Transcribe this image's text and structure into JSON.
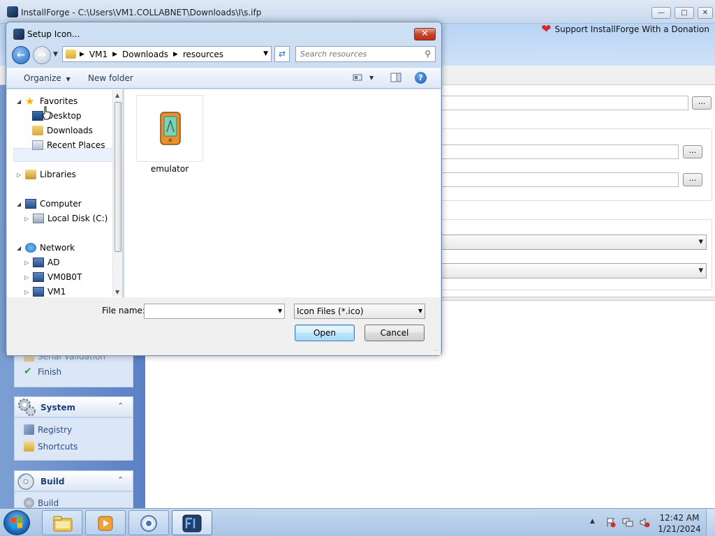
{
  "main_window": {
    "title": "InstallForge - C:\\Users\\VM1.COLLABNET\\Downloads\\I\\s.ifp",
    "donate_label": "Support InstallForge With a Donation",
    "minimize_glyph": "—",
    "maximize_glyph": "□",
    "close_glyph": "✕"
  },
  "sidebar": {
    "partial_item": "Serial Validation",
    "finish_label": "Finish",
    "system_header": "System",
    "registry_label": "Registry",
    "shortcuts_label": "Shortcuts",
    "build_header": "Build",
    "build_item_label": "Build",
    "collapse_glyph": "⌃"
  },
  "main_content": {
    "browse_glyph": "..."
  },
  "dialog": {
    "title": "Setup Icon...",
    "close_glyph": "✕",
    "back_glyph": "←",
    "forward_glyph": "→",
    "breadcrumbs": [
      "VM1",
      "Downloads",
      "resources"
    ],
    "crumb_sep": "▶",
    "search_placeholder": "Search resources",
    "toolbar": {
      "organize_label": "Organize",
      "new_folder_label": "New folder",
      "help_glyph": "?"
    },
    "nav_tree": {
      "favorites": "Favorites",
      "desktop": "Desktop",
      "downloads": "Downloads",
      "recent_places": "Recent Places",
      "libraries": "Libraries",
      "computer": "Computer",
      "local_disk": "Local Disk (C:)",
      "network": "Network",
      "ad": "AD",
      "vm0b0t": "VM0B0T",
      "vm1": "VM1"
    },
    "files": [
      {
        "name": "emulator",
        "type": "ico"
      }
    ],
    "file_name_label": "File name:",
    "file_name_value": "",
    "file_type_value": "Icon Files (*.ico)",
    "open_label": "Open",
    "cancel_label": "Cancel"
  },
  "taskbar": {
    "time": "12:42 AM",
    "date": "1/21/2024",
    "pinned": [
      "windows-explorer",
      "media-player",
      "chrome",
      "installforge"
    ]
  },
  "colors": {
    "accent": "#2568c2",
    "sidebar_bg": "#5b80c5",
    "banner_bg": "#b8d4f4"
  }
}
